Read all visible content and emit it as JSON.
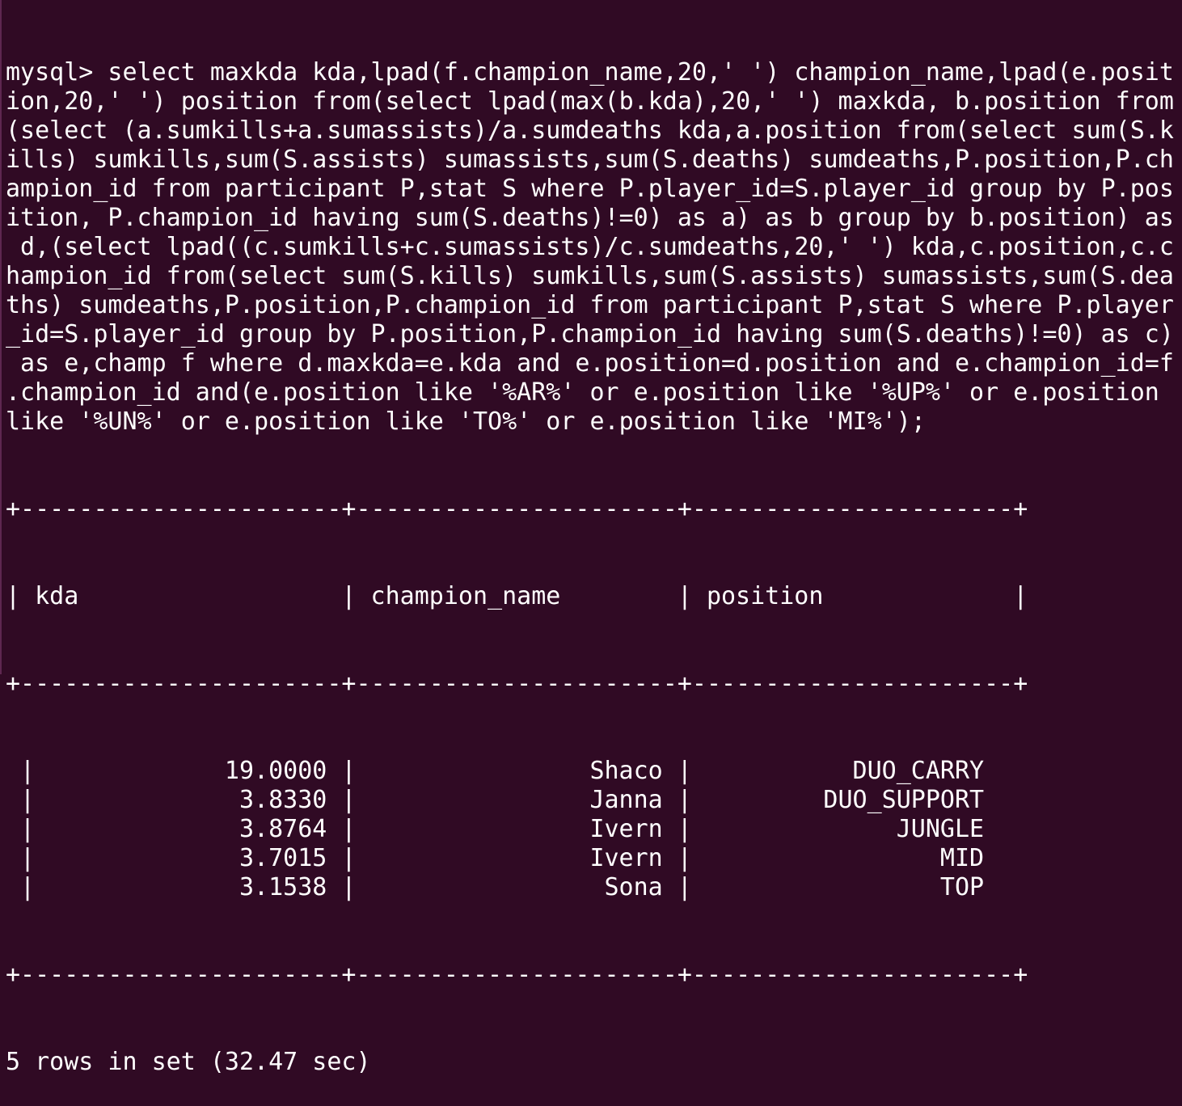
{
  "terminal": {
    "background": "#300a24",
    "foreground": "#ffffff",
    "command_lines": [
      "mysql> select maxkda kda,lpad(f.champion_name,20,' ') champion_name,lpad(e.posit",
      "ion,20,' ') position from(select lpad(max(b.kda),20,' ') maxkda, b.position from",
      "(select (a.sumkills+a.sumassists)/a.sumdeaths kda,a.position from(select sum(S.k",
      "ills) sumkills,sum(S.assists) sumassists,sum(S.deaths) sumdeaths,P.position,P.ch",
      "ampion_id from participant P,stat S where P.player_id=S.player_id group by P.pos",
      "ition, P.champion_id having sum(S.deaths)!=0) as a) as b group by b.position) as",
      " d,(select lpad((c.sumkills+c.sumassists)/c.sumdeaths,20,' ') kda,c.position,c.c",
      "hampion_id from(select sum(S.kills) sumkills,sum(S.assists) sumassists,sum(S.dea",
      "ths) sumdeaths,P.position,P.champion_id from participant P,stat S where P.player",
      "_id=S.player_id group by P.position,P.champion_id having sum(S.deaths)!=0) as c)",
      " as e,champ f where d.maxkda=e.kda and e.position=d.position and e.champion_id=f",
      ".champion_id and(e.position like '%AR%' or e.position like '%UP%' or e.position ",
      "like '%UN%' or e.position like 'TO%' or e.position like 'MI%');"
    ],
    "table": {
      "border": "+----------------------+----------------------+----------------------+",
      "headers": [
        "kda",
        "champion_name",
        "position"
      ],
      "rows": [
        [
          "19.0000",
          "Shaco",
          "DUO_CARRY"
        ],
        [
          "3.8330",
          "Janna",
          "DUO_SUPPORT"
        ],
        [
          "3.8764",
          "Ivern",
          "JUNGLE"
        ],
        [
          "3.7015",
          "Ivern",
          "MID"
        ],
        [
          "3.1538",
          "Sona",
          "TOP"
        ]
      ]
    },
    "status": "5 rows in set (32.47 sec)"
  }
}
